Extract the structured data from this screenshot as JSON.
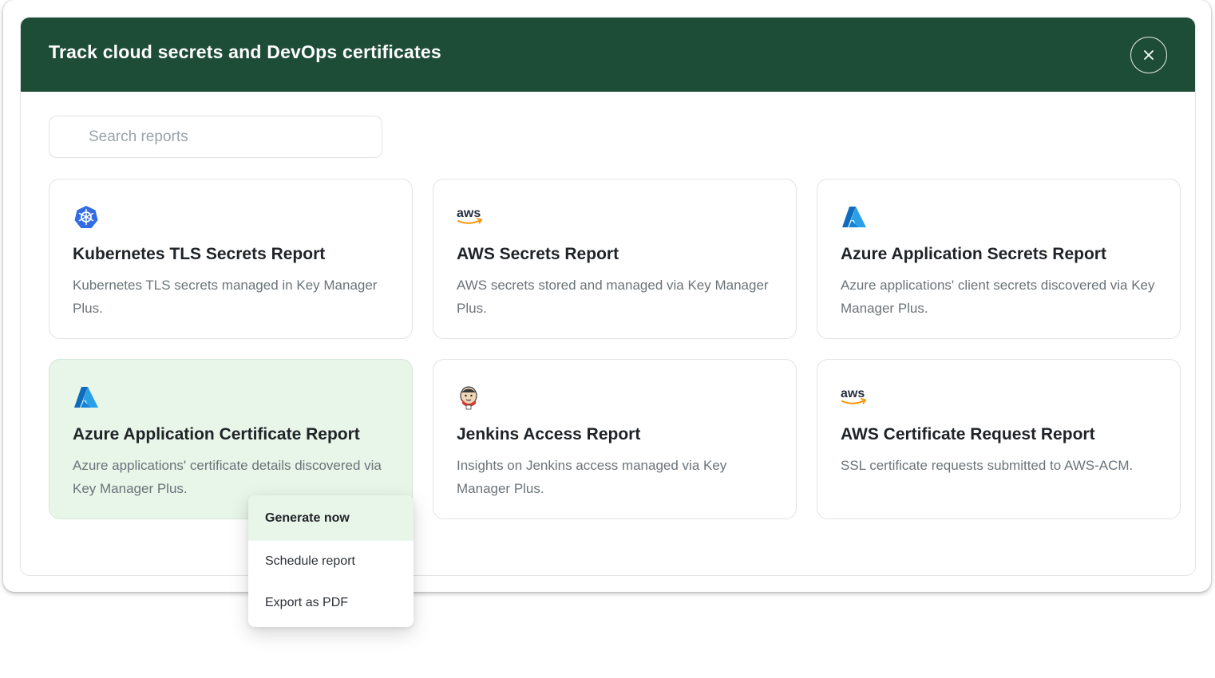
{
  "dialog": {
    "title": "Track cloud secrets and DevOps certificates",
    "close_icon": "close-icon",
    "header_color": "#1e4d37"
  },
  "search": {
    "placeholder": "Search reports",
    "value": ""
  },
  "cards": [
    {
      "icon": "kubernetes-icon",
      "title": "Kubernetes TLS Secrets Report",
      "description": "Kubernetes TLS secrets managed in Key Manager Plus."
    },
    {
      "icon": "aws-icon",
      "logo_text": "aws",
      "title": "AWS Secrets Report",
      "description": "AWS secrets stored and managed via Key Manager Plus."
    },
    {
      "icon": "azure-icon",
      "title": "Azure Application Secrets Report",
      "description": "Azure applications' client secrets discovered via Key Manager Plus."
    },
    {
      "icon": "azure-icon",
      "title": "Azure Application Certificate Report",
      "description": "Azure applications' certificate details discovered via Key Manager Plus.",
      "active": true
    },
    {
      "icon": "jenkins-icon",
      "title": "Jenkins Access Report",
      "description": "Insights on Jenkins access managed via Key Manager Plus."
    },
    {
      "icon": "aws-icon",
      "logo_text": "aws",
      "title": "AWS Certificate Request Report",
      "description": "SSL certificate requests submitted to AWS-ACM."
    }
  ],
  "context_menu": {
    "items": [
      {
        "label": "Generate now",
        "selected": true
      },
      {
        "label": "Schedule report"
      },
      {
        "label": "Export as PDF"
      }
    ]
  },
  "colors": {
    "accent_green": "#1e4d37",
    "active_card_bg": "#e8f5e9",
    "azure_blue": "#0f6cbd",
    "aws_orange": "#f79400",
    "kubernetes_blue": "#326ce5"
  }
}
